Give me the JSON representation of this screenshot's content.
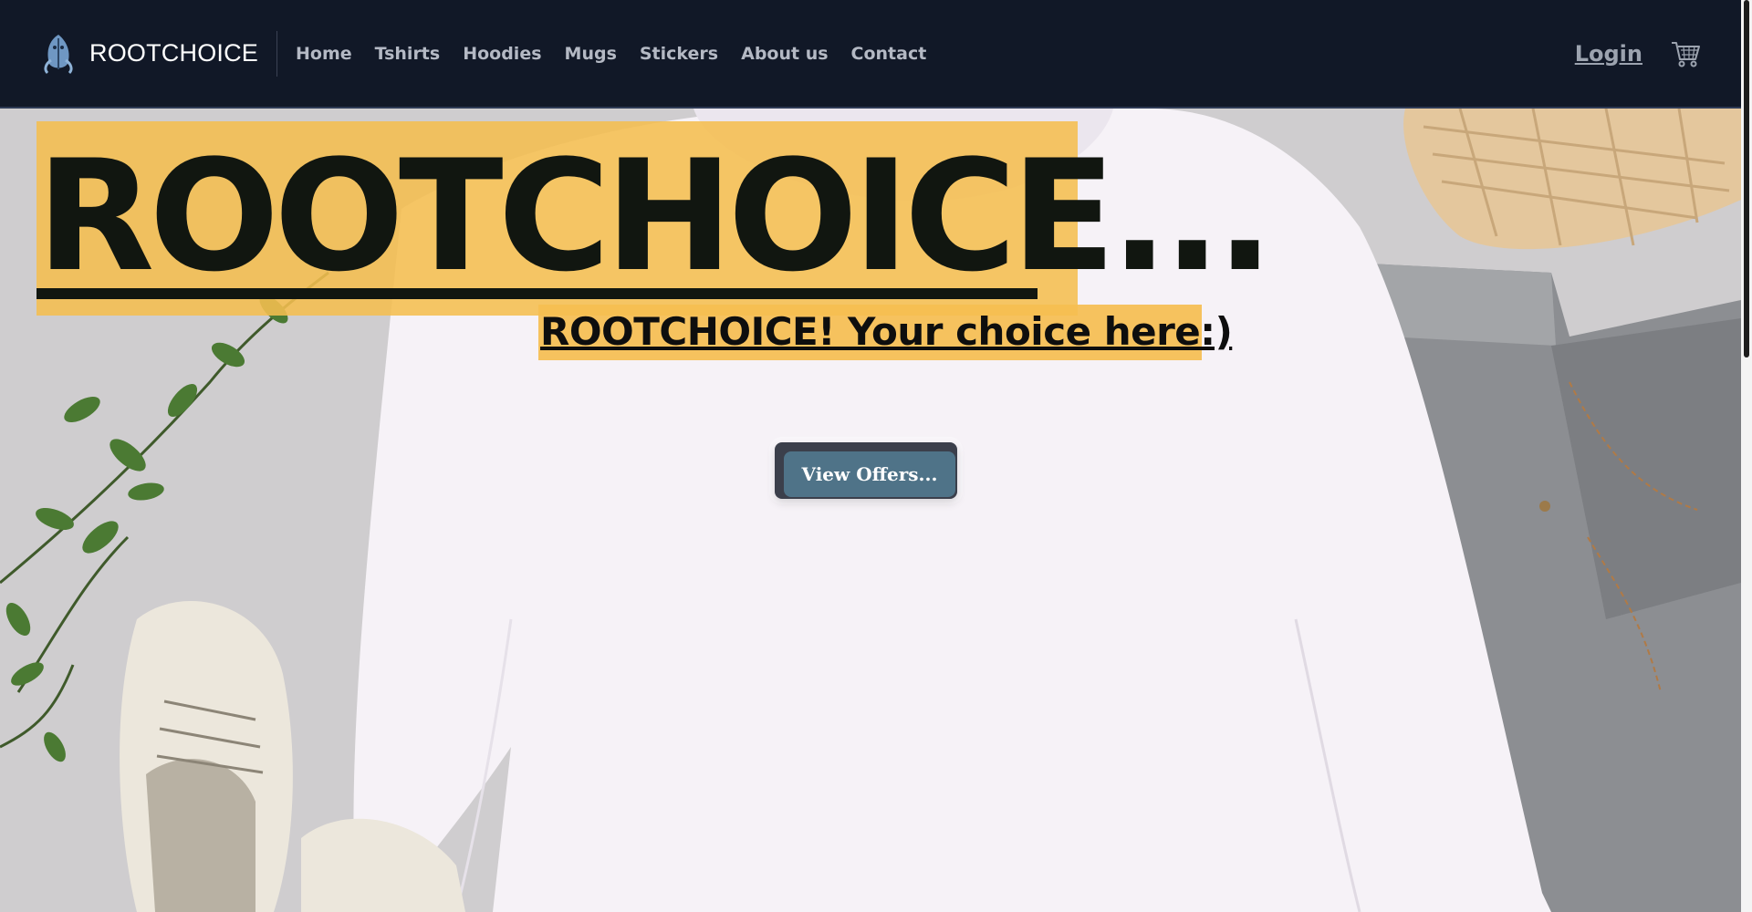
{
  "brand": {
    "name": "ROOTCHOICE",
    "logo_icon": "leaf-sprite-icon"
  },
  "nav": {
    "items": [
      {
        "label": "Home"
      },
      {
        "label": "Tshirts"
      },
      {
        "label": "Hoodies"
      },
      {
        "label": "Mugs"
      },
      {
        "label": "Stickers"
      },
      {
        "label": "About us"
      },
      {
        "label": "Contact"
      }
    ],
    "login_label": "Login",
    "cart_icon": "shopping-cart-icon"
  },
  "hero": {
    "headline": "ROOTCHOICE...",
    "subtitle": "ROOTCHOICE! Your choice here:)",
    "cta_label": "View Offers..."
  },
  "colors": {
    "navbar_bg": "#111827",
    "nav_text": "#b4b9c4",
    "highlight": "#f5be50",
    "cta_bg": "#4f7388",
    "cta_frame": "#3b3f4b"
  }
}
